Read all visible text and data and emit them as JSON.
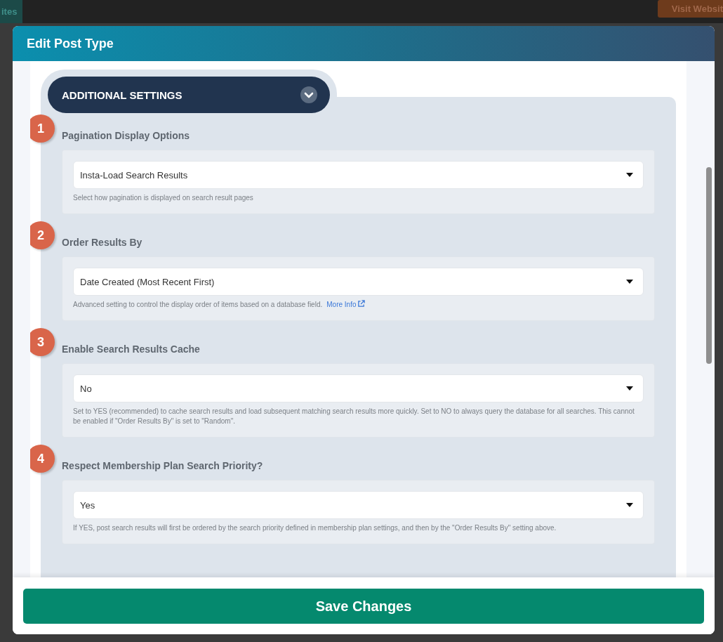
{
  "background": {
    "left_button": "ites",
    "right_button": "Visit Websit"
  },
  "modal": {
    "title": "Edit Post Type",
    "section_title": "ADDITIONAL SETTINGS",
    "settings": [
      {
        "number": "1",
        "label": "Pagination Display Options",
        "value": "Insta-Load Search Results",
        "help": "Select how pagination is displayed on search result pages"
      },
      {
        "number": "2",
        "label": "Order Results By",
        "value": "Date Created (Most Recent First)",
        "help": "Advanced setting to control the display order of items based on a database field.",
        "link": "More Info"
      },
      {
        "number": "3",
        "label": "Enable Search Results Cache",
        "value": "No",
        "help": "Set to YES (recommended) to cache search results and load subsequent matching search results more quickly. Set to NO to always query the database for all searches. This cannot be enabled if \"Order Results By\" is set to \"Random\"."
      },
      {
        "number": "4",
        "label": "Respect Membership Plan Search Priority?",
        "value": "Yes",
        "help": "If YES, post search results will first be ordered by the search priority defined in membership plan settings, and then by the \"Order Results By\" setting above."
      }
    ],
    "save_button": "Save Changes"
  }
}
